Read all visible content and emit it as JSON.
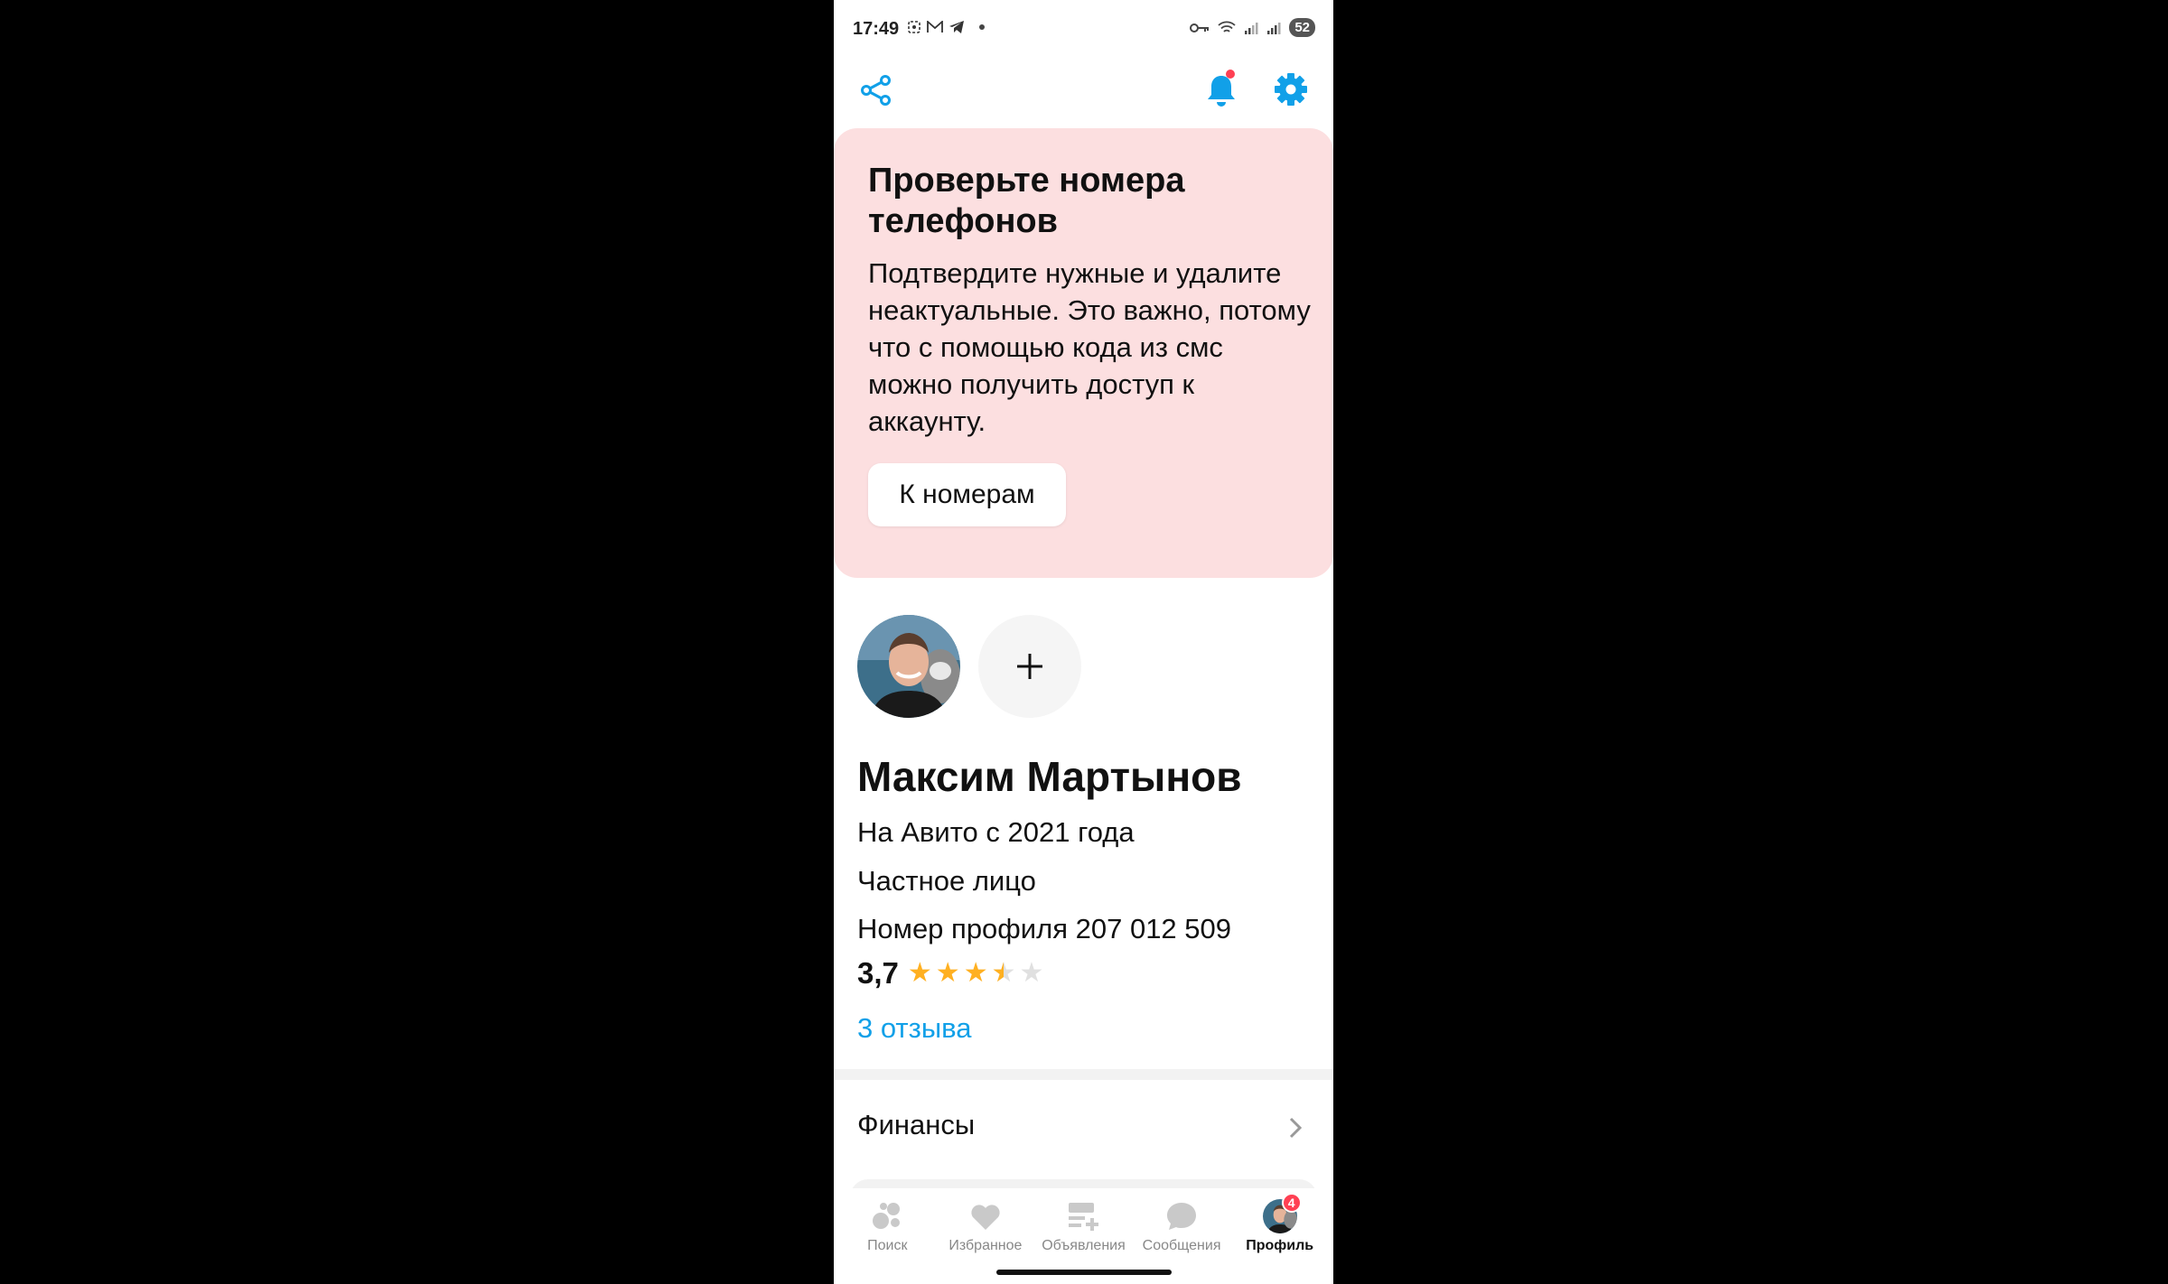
{
  "status_bar": {
    "time": "17:49",
    "battery": "52"
  },
  "colors": {
    "accent": "#11a0e8",
    "banner_bg": "#fcdfe0",
    "star": "#ffb021",
    "badge": "#ff4053"
  },
  "top_bar": {
    "icons": [
      "share-icon",
      "bell-icon",
      "gear-icon"
    ]
  },
  "banner": {
    "title": "Проверьте номера телефонов",
    "text": "Подтвердите нужные и удалите неактуальные. Это важно, потому что с помощью кода из смс можно получить доступ к аккаунту.",
    "button_label": "К номерам"
  },
  "profile": {
    "name": "Максим Мартынов",
    "since": "На Авито с 2021 года",
    "type": "Частное лицо",
    "profile_number": "Номер профиля 207 012 509",
    "rating": "3,7",
    "rating_value": 3.7,
    "stars_max": 5,
    "reviews_link": "3 отзыва"
  },
  "menu": {
    "finance_label": "Финансы"
  },
  "bottom_nav": {
    "items": [
      {
        "label": "Поиск",
        "icon": "search-dots-icon"
      },
      {
        "label": "Избранное",
        "icon": "heart-icon"
      },
      {
        "label": "Объявления",
        "icon": "ads-icon"
      },
      {
        "label": "Сообщения",
        "icon": "message-bubble-icon"
      },
      {
        "label": "Профиль",
        "icon": "profile-avatar-icon",
        "badge": "4",
        "active": true
      }
    ]
  }
}
